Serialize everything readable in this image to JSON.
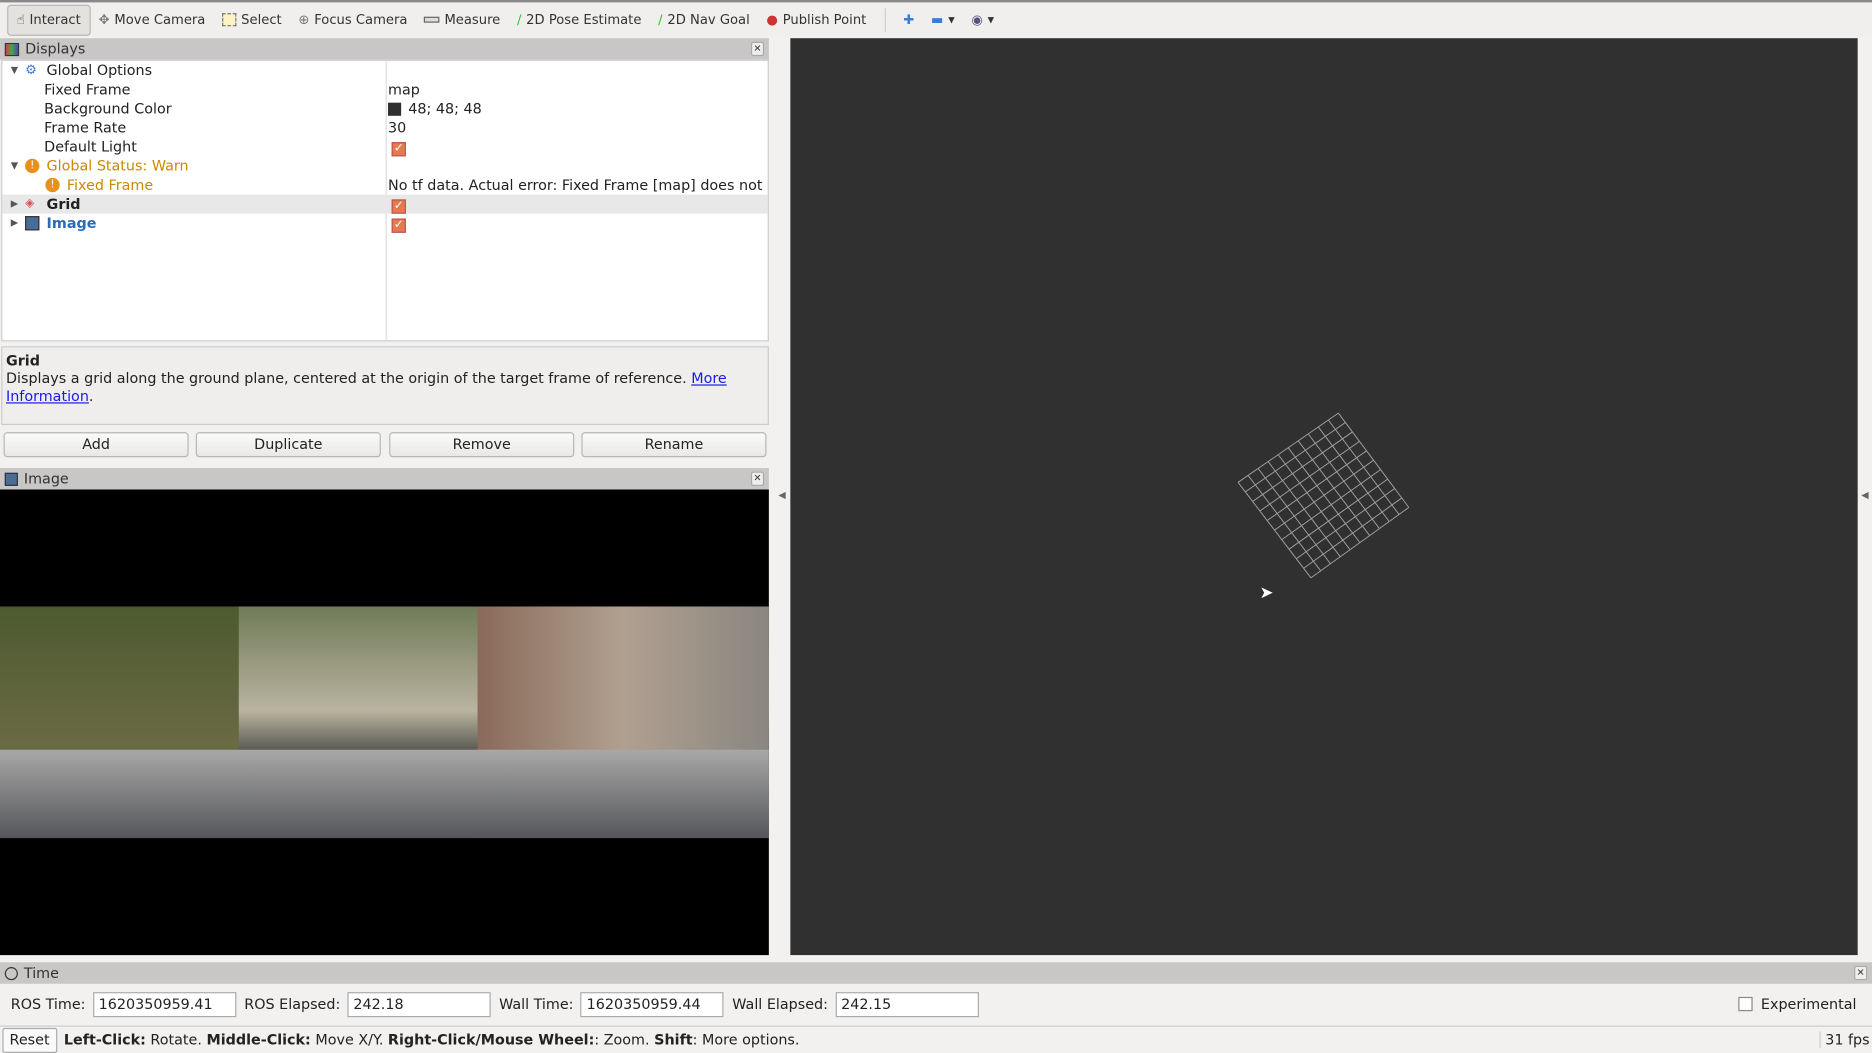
{
  "toolbar": {
    "tools": [
      {
        "label": "Interact",
        "icon": "hand-icon",
        "active": true
      },
      {
        "label": "Move Camera",
        "icon": "move-camera-icon"
      },
      {
        "label": "Select",
        "icon": "select-icon"
      },
      {
        "label": "Focus Camera",
        "icon": "focus-camera-icon"
      },
      {
        "label": "Measure",
        "icon": "ruler-icon"
      },
      {
        "label": "2D Pose Estimate",
        "icon": "green-arrow-icon"
      },
      {
        "label": "2D Nav Goal",
        "icon": "green-arrow-icon"
      },
      {
        "label": "Publish Point",
        "icon": "map-pin-icon"
      }
    ]
  },
  "displays": {
    "title": "Displays",
    "global_options": "Global Options",
    "fixed_frame_label": "Fixed Frame",
    "fixed_frame_value": "map",
    "bg_color_label": "Background Color",
    "bg_color_value": "48; 48; 48",
    "bg_color_hex": "#303030",
    "frame_rate_label": "Frame Rate",
    "frame_rate_value": "30",
    "default_light_label": "Default Light",
    "default_light_checked": true,
    "global_status": "Global Status: Warn",
    "status_fixed_frame": "Fixed Frame",
    "status_error": "No tf data.  Actual error: Fixed Frame [map] does not ...",
    "grid_label": "Grid",
    "grid_checked": true,
    "image_label": "Image",
    "image_checked": true,
    "warn_color": "#c98a00"
  },
  "description": {
    "title": "Grid",
    "text": "Displays a grid along the ground plane, centered at the origin of the target frame of reference. ",
    "link1": "More",
    "link2": "Information",
    "end": "."
  },
  "buttons": {
    "add": "Add",
    "duplicate": "Duplicate",
    "remove": "Remove",
    "rename": "Rename"
  },
  "image_panel": {
    "title": "Image"
  },
  "time": {
    "title": "Time",
    "ros_time_label": "ROS Time:",
    "ros_time": "1620350959.41",
    "ros_elapsed_label": "ROS Elapsed:",
    "ros_elapsed": "242.18",
    "wall_time_label": "Wall Time:",
    "wall_time": "1620350959.44",
    "wall_elapsed_label": "Wall Elapsed:",
    "wall_elapsed": "242.15",
    "experimental": "Experimental"
  },
  "status": {
    "reset": "Reset",
    "h1": "Left-Click:",
    "t1": " Rotate. ",
    "h2": "Middle-Click:",
    "t2": " Move X/Y. ",
    "h3": "Right-Click/Mouse Wheel:",
    "t3": ": Zoom. ",
    "h4": "Shift",
    "t4": ": More options.",
    "fps": "31 fps"
  }
}
